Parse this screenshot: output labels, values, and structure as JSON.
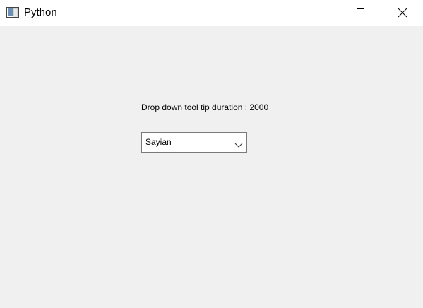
{
  "window": {
    "title": "Python"
  },
  "icons": {
    "app": "app-window-icon",
    "minimize": "minimize-icon",
    "maximize": "maximize-icon",
    "close": "close-icon",
    "dropdown": "chevron-down-icon"
  },
  "main": {
    "label": "Drop down tool tip duration : 2000",
    "combo_selected": "Sayian"
  },
  "colors": {
    "background": "#f0f0f0",
    "titlebar": "#ffffff",
    "combo_border": "#7a7a7a"
  }
}
